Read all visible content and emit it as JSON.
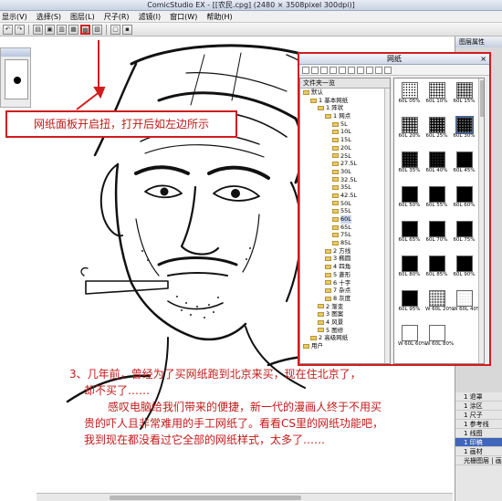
{
  "window": {
    "title": "ComicStudio EX - [[农民.cpg] (2480 × 3508pixel 300dpi)]"
  },
  "menu": {
    "items": [
      "显示(V)",
      "选择(S)",
      "图层(L)",
      "尺子(R)",
      "滤镜(I)",
      "窗口(W)",
      "帮助(H)"
    ]
  },
  "toolbar": {
    "icons": [
      "undo-icon",
      "redo-icon",
      "doc-icon",
      "copy-icon",
      "paste-icon",
      "screentone-icon",
      "grid-icon",
      "window-icon",
      "save-icon"
    ]
  },
  "callout": {
    "text": "网纸面板开启扭，打开后如左边所示"
  },
  "tone_panel": {
    "title": "网纸",
    "tree_header": "文件夹一览",
    "tree": [
      {
        "label": "默认",
        "level": 0
      },
      {
        "label": "1 基本网纸",
        "level": 1
      },
      {
        "label": "1 阵状",
        "level": 2
      },
      {
        "label": "1 网点",
        "level": 3
      },
      {
        "label": "5L",
        "level": 4
      },
      {
        "label": "10L",
        "level": 4
      },
      {
        "label": "15L",
        "level": 4
      },
      {
        "label": "20L",
        "level": 4
      },
      {
        "label": "25L",
        "level": 4
      },
      {
        "label": "27.5L",
        "level": 4
      },
      {
        "label": "30L",
        "level": 4
      },
      {
        "label": "32.5L",
        "level": 4
      },
      {
        "label": "35L",
        "level": 4
      },
      {
        "label": "42.5L",
        "level": 4
      },
      {
        "label": "50L",
        "level": 4
      },
      {
        "label": "55L",
        "level": 4
      },
      {
        "label": "60L",
        "level": 4,
        "selected": true
      },
      {
        "label": "65L",
        "level": 4
      },
      {
        "label": "75L",
        "level": 4
      },
      {
        "label": "85L",
        "level": 4
      },
      {
        "label": "2 方线",
        "level": 3
      },
      {
        "label": "3 椭圆",
        "level": 3
      },
      {
        "label": "4 四角",
        "level": 3
      },
      {
        "label": "5 菱形",
        "level": 3
      },
      {
        "label": "6 十字",
        "level": 3
      },
      {
        "label": "7 杂点",
        "level": 3
      },
      {
        "label": "8 灰度",
        "level": 3
      },
      {
        "label": "2 渐变",
        "level": 2
      },
      {
        "label": "3 图案",
        "level": 2
      },
      {
        "label": "4 风景",
        "level": 2
      },
      {
        "label": "5 图修",
        "level": 2
      },
      {
        "label": "2 高级网纸",
        "level": 1
      },
      {
        "label": "用户",
        "level": 0
      }
    ],
    "tones": [
      {
        "label": "60L 05%",
        "density": 0.05
      },
      {
        "label": "60L 10%",
        "density": 0.1
      },
      {
        "label": "60L 15%",
        "density": 0.15
      },
      {
        "label": "60L 20%",
        "density": 0.2
      },
      {
        "label": "60L 25%",
        "density": 0.25
      },
      {
        "label": "60L 30%",
        "density": 0.3,
        "selected": true
      },
      {
        "label": "60L 35%",
        "density": 0.35
      },
      {
        "label": "60L 40%",
        "density": 0.4
      },
      {
        "label": "60L 45%",
        "density": 0.45
      },
      {
        "label": "60L 50%",
        "density": 0.5
      },
      {
        "label": "60L 55%",
        "density": 0.55
      },
      {
        "label": "60L 60%",
        "density": 0.6
      },
      {
        "label": "60L 65%",
        "density": 0.65
      },
      {
        "label": "60L 70%",
        "density": 0.7
      },
      {
        "label": "60L 75%",
        "density": 0.75
      },
      {
        "label": "60L 80%",
        "density": 0.8
      },
      {
        "label": "60L 85%",
        "density": 0.85
      },
      {
        "label": "60L 90%",
        "density": 0.9
      },
      {
        "label": "60L 95%",
        "density": 0.95
      },
      {
        "label": "W 60L 20%",
        "density": 0.2
      },
      {
        "label": "W 60L 40%",
        "density": 0.4
      },
      {
        "label": "W 60L 60%",
        "density": 0.6
      },
      {
        "label": "W 60L 80%",
        "density": 0.8
      }
    ]
  },
  "right_panel": {
    "header": "图层属性",
    "layers": [
      "1 退罩",
      "1 涂区",
      "1 尺子",
      "1 参考线",
      "1 线图",
      "1 印稿",
      "1 画材"
    ],
    "footer": "光栅图层 | 画材"
  },
  "captions": [
    "3、几年前，曾经为了买网纸跑到北京来买，现在住北京了，",
    "却不买了……",
    "感叹电脑给我们带来的便捷，新一代的漫画人终于不用买",
    "贵的吓人且非常难用的手工网纸了。看看CS里的网纸功能吧，",
    "我到现在都没看过它全部的网纸样式，太多了……"
  ],
  "colors": {
    "annotation_red": "#d21c1c",
    "selection_blue": "#3f66b8"
  }
}
